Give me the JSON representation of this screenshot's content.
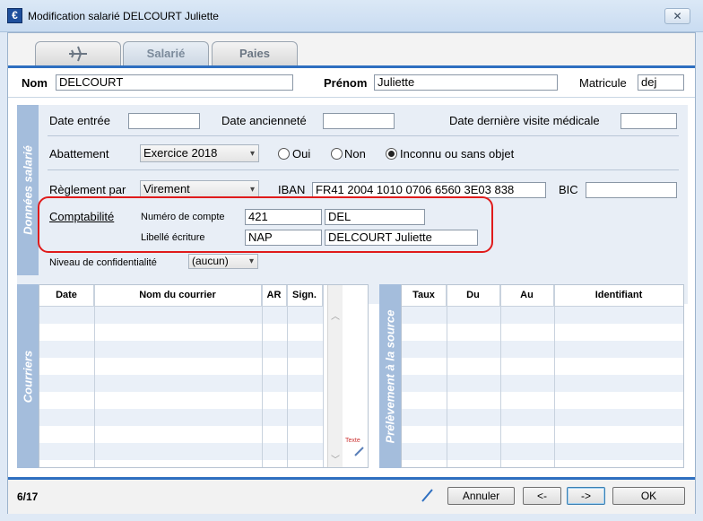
{
  "window": {
    "title": "Modification salarié DELCOURT Juliette",
    "app_icon_glyph": "€",
    "close_glyph": "✕"
  },
  "tabs": [
    {
      "label": "",
      "icon": "plane-icon"
    },
    {
      "label": "Salarié"
    },
    {
      "label": "Paies"
    }
  ],
  "identity": {
    "nom_label": "Nom",
    "nom_value": "DELCOURT",
    "prenom_label": "Prénom",
    "prenom_value": "Juliette",
    "matricule_label": "Matricule",
    "matricule_value": "dej"
  },
  "donnees": {
    "section_label": "Données salarié",
    "date_entree_label": "Date entrée",
    "date_entree_value": "",
    "date_anciennete_label": "Date ancienneté",
    "date_anciennete_value": "",
    "date_visite_label": "Date dernière visite médicale",
    "date_visite_value": "",
    "abattement_label": "Abattement",
    "abattement_value": "Exercice 2018",
    "radio_oui": "Oui",
    "radio_non": "Non",
    "radio_inconnu": "Inconnu ou sans objet",
    "reglement_label": "Règlement par",
    "reglement_value": "Virement",
    "iban_label": "IBAN",
    "iban_value": "FR41 2004 1010 0706 6560 3E03 838",
    "bic_label": "BIC",
    "bic_value": "",
    "comptabilite_label": "Comptabilité",
    "numero_compte_label": "Numéro de compte",
    "numero_compte_value": "421",
    "numero_compte_suffix": "DEL",
    "libelle_label": "Libellé écriture",
    "libelle_value": "NAP",
    "libelle_suffix": "DELCOURT Juliette",
    "niveau_label": "Niveau de confidentialité",
    "niveau_value": "(aucun)"
  },
  "courriers": {
    "section_label": "Courriers",
    "columns": [
      "Date",
      "Nom du courrier",
      "AR",
      "Sign."
    ],
    "texte_label": "Texte"
  },
  "prelevement": {
    "section_label": "Prélèvement à la source",
    "columns": [
      "Taux",
      "Du",
      "Au",
      "Identifiant"
    ]
  },
  "footer": {
    "page_indicator": "6/17",
    "annuler": "Annuler",
    "prev": "<-",
    "next": "->",
    "ok": "OK"
  },
  "colors": {
    "accent": "#2e6fc0",
    "side_tab": "#a4bddc",
    "highlight_box": "#e01b1b"
  }
}
